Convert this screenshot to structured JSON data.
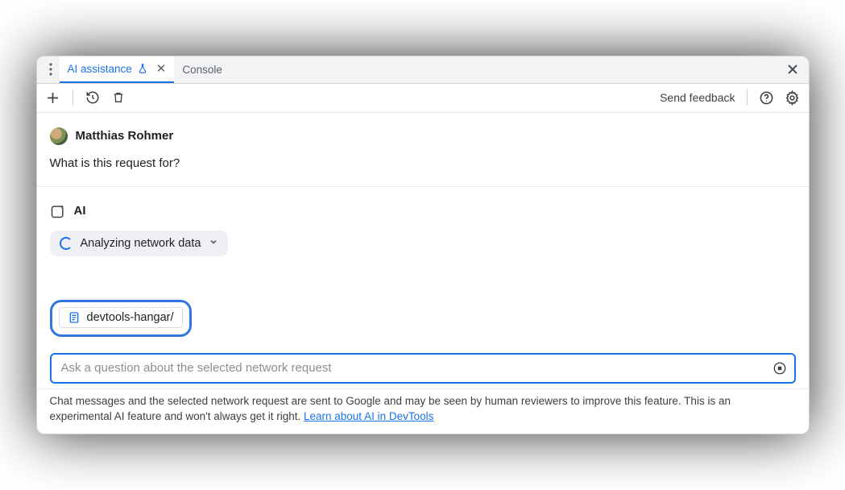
{
  "tabs": {
    "ai_assistance": "AI assistance",
    "console": "Console"
  },
  "toolbar": {
    "send_feedback": "Send feedback"
  },
  "conversation": {
    "user_name": "Matthias Rohmer",
    "user_question": "What is this request for?",
    "ai_label": "AI",
    "analyzing_text": "Analyzing network data"
  },
  "chip": {
    "label": "devtools-hangar/"
  },
  "input": {
    "placeholder": "Ask a question about the selected network request"
  },
  "footer": {
    "text_before": "Chat messages and the selected network request are sent to Google and may be seen by human reviewers to improve this feature. This is an experimental AI feature and won't always get it right. ",
    "link_text": "Learn about AI in DevTools"
  }
}
